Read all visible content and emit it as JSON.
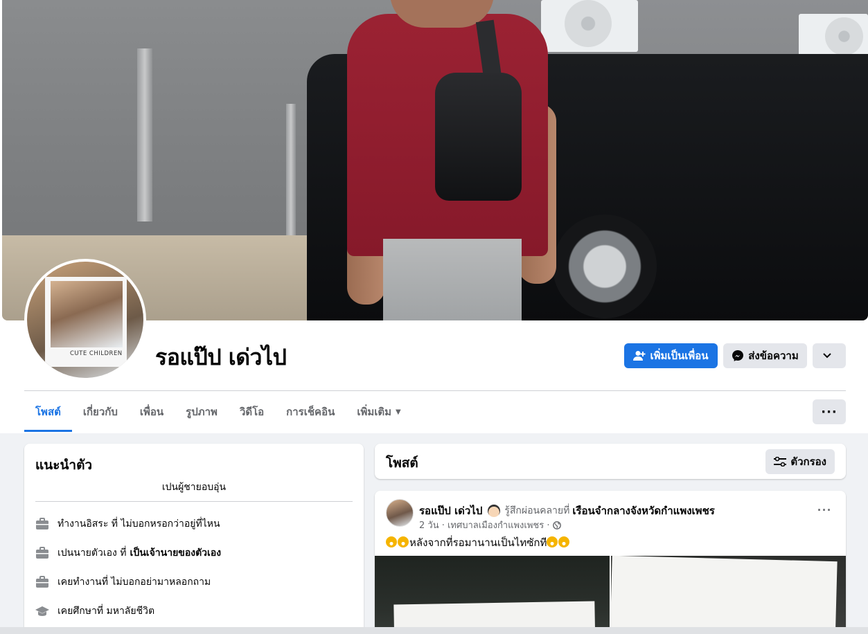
{
  "profile": {
    "name": "รอแป๊ป เด่วไป",
    "avatar_caption": "CUTE CHILDREN"
  },
  "actions": {
    "add_friend": "เพิ่มเป็นเพื่อน",
    "message": "ส่งข้อความ"
  },
  "tabs": [
    {
      "label": "โพสต์",
      "active": true
    },
    {
      "label": "เกี่ยวกับ"
    },
    {
      "label": "เพื่อน"
    },
    {
      "label": "รูปภาพ"
    },
    {
      "label": "วิดีโอ"
    },
    {
      "label": "การเช็คอิน"
    },
    {
      "label": "เพิ่มเติม"
    }
  ],
  "intro": {
    "title": "แนะนำตัว",
    "bio": "เปนผู้ชายอบอุ่น",
    "items": [
      {
        "icon": "briefcase-icon",
        "text": "ทำงานอิสระ ที่ ไม่บอกหรอกว่าอยู่ที่ไหน",
        "bold": ""
      },
      {
        "icon": "briefcase-icon",
        "text": "เปนนายตัวเอง ที่",
        "bold": "เป็นเจ้านายของตัวเอง"
      },
      {
        "icon": "briefcase-icon",
        "text": "เคยทำงานที่ ไม่บอกอย่ามาหลอกถาม",
        "bold": ""
      },
      {
        "icon": "graduation-cap-icon",
        "text": "เคยศึกษาที่ มหาลัยชีวิต",
        "bold": ""
      }
    ]
  },
  "posts_header": {
    "title": "โพสต์",
    "filter_label": "ตัวกรอง"
  },
  "post": {
    "author": "รอแป๊ป เด่วไป",
    "feeling": "รู้สึกผ่อนคลายที่",
    "location": "เรือนจำกลางจังหวัดกำแพงเพชร",
    "meta": "2 วัน · เทศบาลเมืองกำแพงเพชร ·",
    "text": "หลังจากที่รอมานานเป็นไทซักที",
    "more": "···"
  },
  "colors": {
    "primary": "#1b74e4",
    "page_bg": "#f0f2f5"
  }
}
